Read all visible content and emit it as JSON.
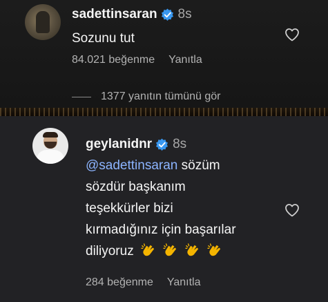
{
  "comments": [
    {
      "username": "sadettinsaran",
      "time": "8s",
      "text": "Sozunu tut",
      "likes": "84.021 beğenme",
      "reply": "Yanıtla",
      "view_replies": "1377 yanıtın tümünü gör"
    },
    {
      "username": "geylanidnr",
      "time": "8s",
      "mention": "@sadettinsaran",
      "text_line1": " sözüm",
      "text_line2": "sözdür başkanım",
      "text_line3": "teşekkürler bizi",
      "text_line4": "kırmadığınız için başarılar",
      "text_line5": "diliyoruz",
      "likes": "284 beğenme",
      "reply": "Yanıtla"
    }
  ],
  "colors": {
    "verified_badge": "#3897f0",
    "mention": "#8cb4ff",
    "secondary_text": "#a8a8a8"
  },
  "icons": [
    "verified-badge-icon",
    "heart-icon",
    "clapping-hands-emoji"
  ]
}
